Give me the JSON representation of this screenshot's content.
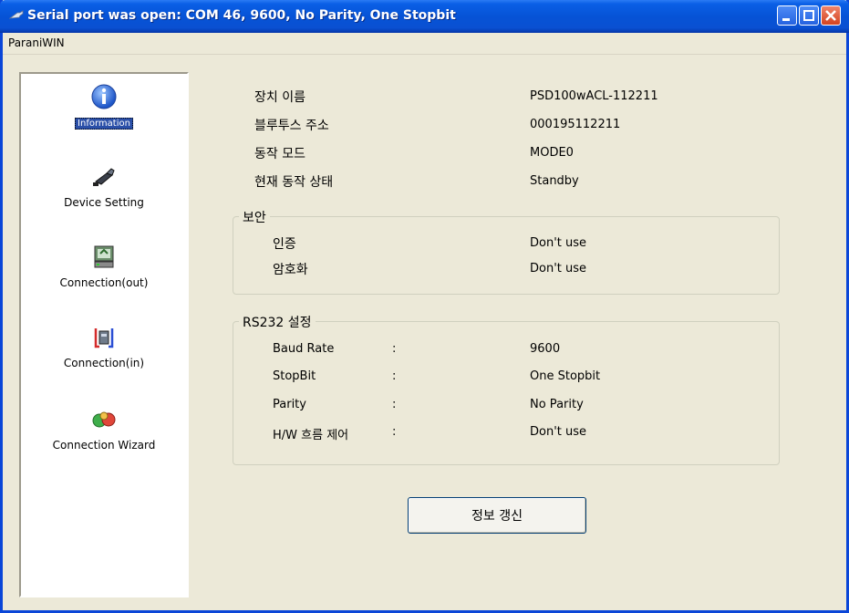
{
  "window": {
    "title": "Serial port was open: COM 46, 9600, No Parity, One Stopbit"
  },
  "menu": {
    "items": [
      "ParaniWIN"
    ]
  },
  "sidebar": {
    "items": [
      {
        "label": "Information",
        "icon": "info-icon",
        "selected": true
      },
      {
        "label": "Device Setting",
        "icon": "device-setting-icon",
        "selected": false
      },
      {
        "label": "Connection(out)",
        "icon": "connection-out-icon",
        "selected": false
      },
      {
        "label": "Connection(in)",
        "icon": "connection-in-icon",
        "selected": false
      },
      {
        "label": "Connection Wizard",
        "icon": "connection-wizard-icon",
        "selected": false
      }
    ]
  },
  "info": {
    "device_name_label": "장치 이름",
    "device_name_value": "PSD100wACL-112211",
    "bt_address_label": "블루투스 주소",
    "bt_address_value": "000195112211",
    "mode_label": "동작 모드",
    "mode_value": "MODE0",
    "status_label": "현재 동작 상태",
    "status_value": "Standby"
  },
  "security": {
    "title": "보안",
    "auth_label": "인증",
    "auth_value": "Don't use",
    "encrypt_label": "암호화",
    "encrypt_value": "Don't use"
  },
  "rs232": {
    "title": "RS232 설정",
    "rows": [
      {
        "label": "Baud Rate",
        "sep": ":",
        "value": "9600"
      },
      {
        "label": "StopBit",
        "sep": ":",
        "value": "One Stopbit"
      },
      {
        "label": "Parity",
        "sep": ":",
        "value": "No Parity"
      },
      {
        "label": "H/W 흐름 제어",
        "sep": ":",
        "value": "Don't use"
      }
    ]
  },
  "actions": {
    "refresh_label": "정보 갱신"
  },
  "colors": {
    "titlebar": "#0653d6",
    "window_bg": "#ece9d8",
    "selected_bg": "#2a4fa8",
    "close_btn": "#d3431f"
  }
}
